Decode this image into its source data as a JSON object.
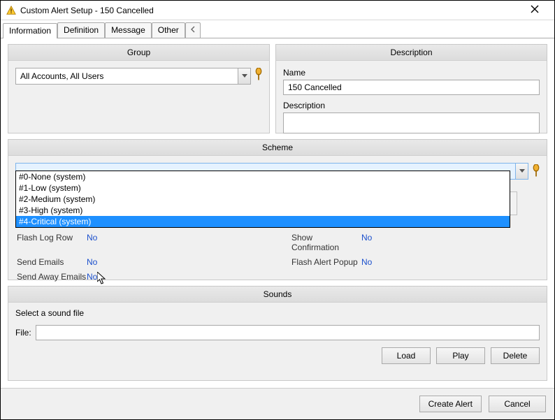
{
  "window": {
    "title": "Custom Alert Setup - 150 Cancelled"
  },
  "tabs": {
    "items": [
      "Information",
      "Definition",
      "Message",
      "Other"
    ],
    "active": 0
  },
  "group": {
    "header": "Group",
    "selected": "All Accounts, All Users"
  },
  "description": {
    "header": "Description",
    "name_label": "Name",
    "name_value": "150 Cancelled",
    "desc_label": "Description",
    "desc_value": ""
  },
  "scheme": {
    "header": "Scheme",
    "selected": "",
    "options": [
      "#0-None (system)",
      "#1-Low (system)",
      "#2-Medium (system)",
      "#3-High (system)",
      "#4-Critical (system)"
    ],
    "highlighted_index": 4,
    "settings": [
      {
        "k": "Flash Log Row",
        "v": "No"
      },
      {
        "k": "Show Confirmation",
        "v": "No"
      },
      {
        "k": "Send Emails",
        "v": "No"
      },
      {
        "k": "Flash Alert Popup",
        "v": "No"
      },
      {
        "k": "Send Away Emails",
        "v": "No"
      }
    ]
  },
  "sounds": {
    "header": "Sounds",
    "prompt": "Select a sound file",
    "file_label": "File:",
    "file_value": "",
    "buttons": {
      "load": "Load",
      "play": "Play",
      "delete": "Delete"
    }
  },
  "footer": {
    "create": "Create Alert",
    "cancel": "Cancel"
  }
}
